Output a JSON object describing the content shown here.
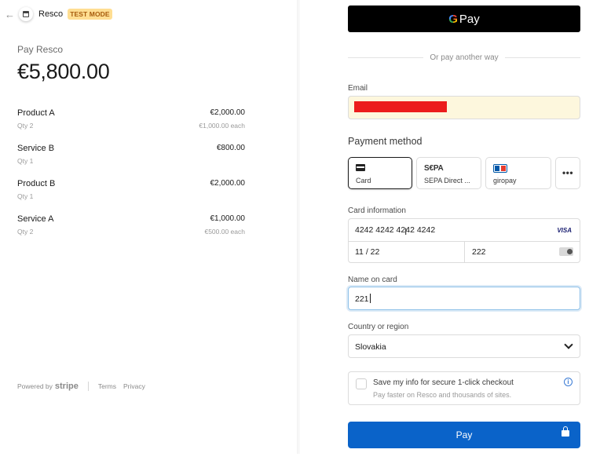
{
  "header": {
    "merchant": "Resco",
    "badge": "TEST MODE",
    "back_icon": "arrow-left-icon"
  },
  "summary": {
    "pay_label": "Pay Resco",
    "total": "€5,800.00",
    "items": [
      {
        "name": "Product A",
        "qty": "Qty 2",
        "price": "€2,000.00",
        "each": "€1,000.00 each"
      },
      {
        "name": "Service B",
        "qty": "Qty 1",
        "price": "€800.00",
        "each": ""
      },
      {
        "name": "Product B",
        "qty": "Qty 1",
        "price": "€2,000.00",
        "each": ""
      },
      {
        "name": "Service A",
        "qty": "Qty 2",
        "price": "€1,000.00",
        "each": "€500.00 each"
      }
    ]
  },
  "footer": {
    "powered_by": "Powered by",
    "brand": "stripe",
    "terms": "Terms",
    "privacy": "Privacy"
  },
  "wallet": {
    "g": "G",
    "pay": "Pay"
  },
  "divider_text": "Or pay another way",
  "email": {
    "label": "Email"
  },
  "payment_method": {
    "title": "Payment method",
    "tabs": [
      {
        "label": "Card",
        "icon": "card-icon"
      },
      {
        "label": "SEPA Direct ...",
        "icon": "sepa-icon",
        "icon_text": "S€PA"
      },
      {
        "label": "giropay",
        "icon": "giropay-icon"
      },
      {
        "label": "•••",
        "icon": "more-icon"
      }
    ]
  },
  "card": {
    "label": "Card information",
    "number": "4242 4242 4242 4242",
    "brand": "VISA",
    "expiry": "11 / 22",
    "cvc": "222"
  },
  "name": {
    "label": "Name on card",
    "value": "221"
  },
  "country": {
    "label": "Country or region",
    "value": "Slovakia"
  },
  "save_info": {
    "title": "Save my info for secure 1-click checkout",
    "subtitle": "Pay faster on Resco and thousands of sites.",
    "info_glyph": "i"
  },
  "pay_button": {
    "label": "Pay"
  },
  "colors": {
    "accent": "#0a63c9",
    "badge_bg": "#ffde92",
    "badge_text": "#a65b0c",
    "email_bg": "#fdf7dd",
    "redaction": "#ec1c1c"
  }
}
